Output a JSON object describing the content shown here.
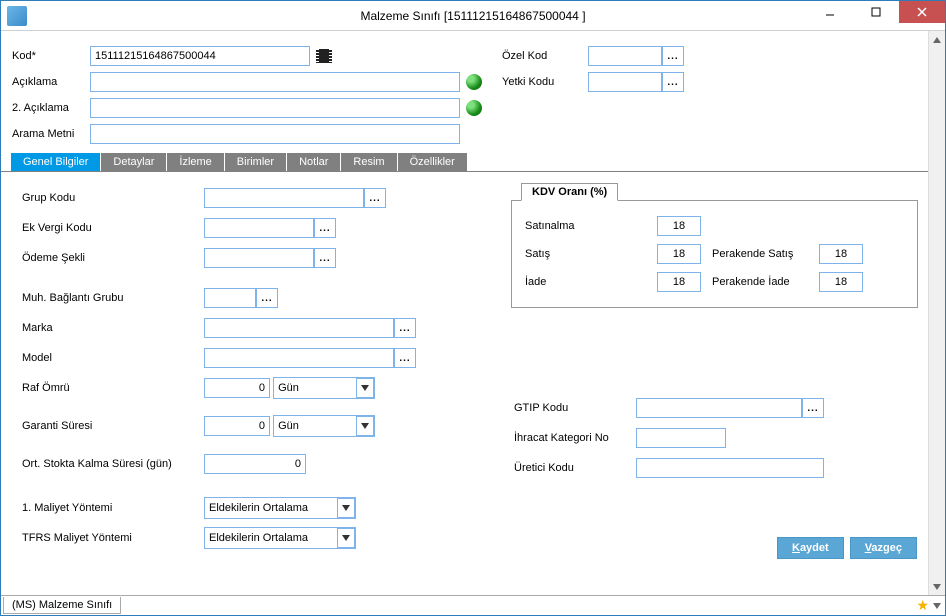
{
  "window": {
    "title": "Malzeme Sınıfı [15111215164867500044 ]"
  },
  "header": {
    "kod_label": "Kod*",
    "kod_value": "15111215164867500044",
    "aciklama_label": "Açıklama",
    "aciklama_value": "",
    "aciklama2_label": "2. Açıklama",
    "aciklama2_value": "",
    "arama_label": "Arama Metni",
    "arama_value": "",
    "ozelkod_label": "Özel Kod",
    "ozelkod_value": "",
    "yetkikodu_label": "Yetki Kodu",
    "yetkikodu_value": ""
  },
  "tabs": [
    "Genel Bilgiler",
    "Detaylar",
    "İzleme",
    "Birimler",
    "Notlar",
    "Resim",
    "Özellikler"
  ],
  "general": {
    "grup_kodu_label": "Grup Kodu",
    "grup_kodu_value": "",
    "ek_vergi_label": "Ek Vergi Kodu",
    "ek_vergi_value": "",
    "odeme_sekli_label": "Ödeme Şekli",
    "odeme_sekli_value": "",
    "muh_bag_label": "Muh. Bağlantı Grubu",
    "muh_bag_value": "",
    "marka_label": "Marka",
    "marka_value": "",
    "model_label": "Model",
    "model_value": "",
    "raf_omru_label": "Raf Ömrü",
    "raf_omru_value": "0",
    "raf_omru_unit": "Gün",
    "garanti_label": "Garanti Süresi",
    "garanti_value": "0",
    "garanti_unit": "Gün",
    "ort_stok_label": "Ort. Stokta Kalma Süresi (gün)",
    "ort_stok_value": "0",
    "maliyet1_label": "1. Maliyet Yöntemi",
    "maliyet1_value": "Eldekilerin Ortalama",
    "tfrs_label": "TFRS Maliyet Yöntemi",
    "tfrs_value": "Eldekilerin Ortalama"
  },
  "kdv": {
    "title": "KDV Oranı (%)",
    "satinalma_label": "Satınalma",
    "satinalma_value": "18",
    "satis_label": "Satış",
    "satis_value": "18",
    "iade_label": "İade",
    "iade_value": "18",
    "per_satis_label": "Perakende Satış",
    "per_satis_value": "18",
    "per_iade_label": "Perakende İade",
    "per_iade_value": "18"
  },
  "right_lower": {
    "gtip_label": "GTIP Kodu",
    "gtip_value": "",
    "ihracat_label": "İhracat Kategori No",
    "ihracat_value": "",
    "uretici_label": "Üretici Kodu",
    "uretici_value": ""
  },
  "actions": {
    "save": "Kaydet",
    "cancel": "Vazgeç"
  },
  "status": {
    "tab": "(MS) Malzeme Sınıfı"
  }
}
